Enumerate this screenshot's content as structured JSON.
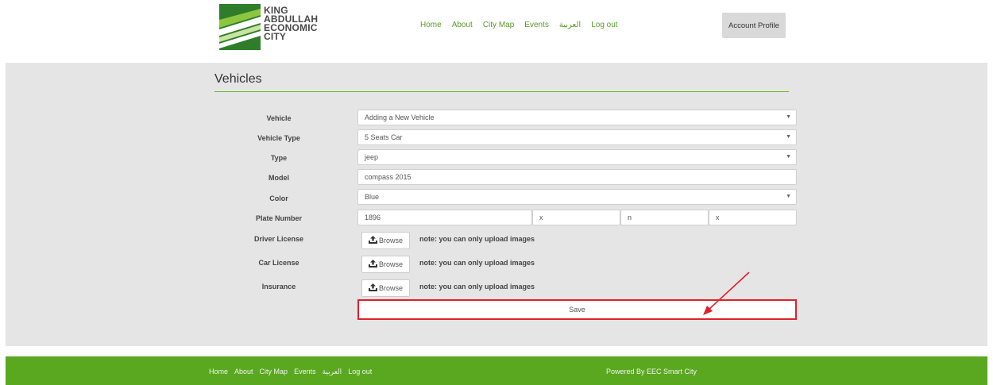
{
  "header": {
    "logo_lines": [
      "KING",
      "ABDULLAH",
      "ECONOMIC",
      "CITY"
    ],
    "nav": [
      "Home",
      "About",
      "City Map",
      "Events",
      "العربية",
      "Log out"
    ],
    "account_button": "Account Profile"
  },
  "page": {
    "title": "Vehicles"
  },
  "form": {
    "vehicle": {
      "label": "Vehicle",
      "value": "Adding a New Vehicle"
    },
    "vehicle_type": {
      "label": "Vehicle Type",
      "value": "5 Seats Car"
    },
    "type": {
      "label": "Type",
      "value": "jeep"
    },
    "model": {
      "label": "Model",
      "value": "compass 2015"
    },
    "color": {
      "label": "Color",
      "value": "Blue"
    },
    "plate": {
      "label": "Plate Number",
      "number": "1896",
      "letter1": "x",
      "letter2": "n",
      "letter3": "x"
    },
    "driver_license": {
      "label": "Driver License",
      "browse": "Browse",
      "note": "note: you can only upload images"
    },
    "car_license": {
      "label": "Car License",
      "browse": "Browse",
      "note": "note: you can only upload images"
    },
    "insurance": {
      "label": "Insurance",
      "browse": "Browse",
      "note": "note: you can only upload images"
    },
    "save": "Save"
  },
  "footer": {
    "nav": [
      "Home",
      "About",
      "City Map",
      "Events",
      "العربية",
      "Log out"
    ],
    "credit": "Powered By EEC Smart City"
  },
  "colors": {
    "brand_green": "#5aa81f",
    "highlight_red": "#e0202a"
  },
  "icons": {
    "upload": "upload-icon",
    "dropdown": "chevron-down-icon"
  }
}
